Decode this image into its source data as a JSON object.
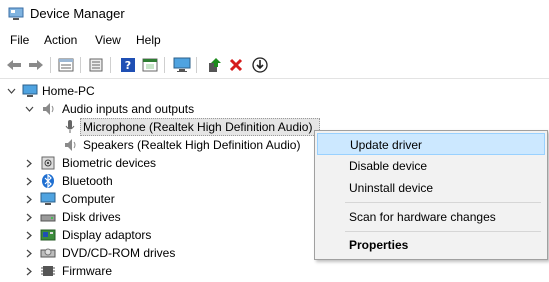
{
  "window": {
    "title": "Device Manager"
  },
  "menu": [
    "File",
    "Action",
    "View",
    "Help"
  ],
  "toolbar": {
    "buttons": [
      "back-icon",
      "forward-icon",
      "properties-icon",
      "show-hidden-icon",
      "help-icon",
      "update-view-icon",
      "monitor-scan-icon",
      "update-driver-icon",
      "uninstall-icon",
      "download-icon"
    ],
    "colors": {
      "help": "#1f4fb4",
      "uninstall": "#d51a1a",
      "update": "#1c8a1c"
    }
  },
  "tree": {
    "root": "Home-PC",
    "categories": [
      {
        "label": "Audio inputs and outputs",
        "expanded": true,
        "children": [
          "Microphone (Realtek High Definition Audio)",
          "Speakers (Realtek High Definition Audio)"
        ]
      },
      {
        "label": "Biometric devices"
      },
      {
        "label": "Bluetooth"
      },
      {
        "label": "Computer"
      },
      {
        "label": "Disk drives"
      },
      {
        "label": "Display adaptors"
      },
      {
        "label": "DVD/CD-ROM drives"
      },
      {
        "label": "Firmware"
      }
    ]
  },
  "context_menu": {
    "items": [
      "Update driver",
      "Disable device",
      "Uninstall device",
      "Scan for hardware changes",
      "Properties"
    ],
    "highlighted": "Update driver",
    "default": "Properties"
  }
}
